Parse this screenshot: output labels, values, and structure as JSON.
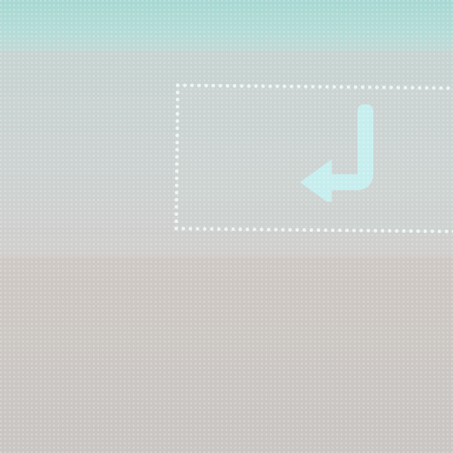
{
  "window": {
    "top_bar_color": "#a8d8d3",
    "toolbar_color": "#c9d2d1"
  },
  "toolbar": {
    "enter_button": {
      "icon": "enter-return-icon",
      "icon_color": "#c4ecec",
      "border_color": "#eef6f5"
    }
  }
}
